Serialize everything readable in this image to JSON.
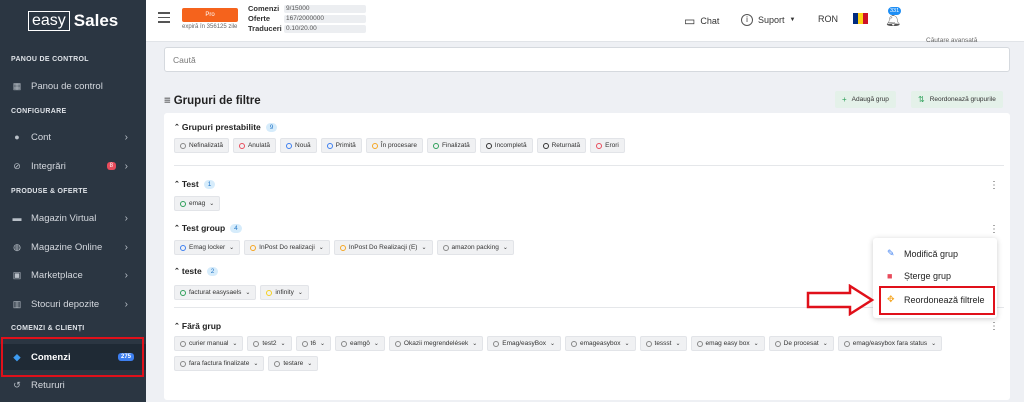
{
  "brand": {
    "logo_box": "easy",
    "logo_bold": "Sales"
  },
  "sidebar": {
    "sections": [
      "PANOU DE CONTROL",
      "CONFIGURARE",
      "PRODUSE & OFERTE",
      "COMENZI & CLIENȚI"
    ],
    "items": [
      {
        "label": "Panou de control",
        "icon": "dashboard-icon",
        "glyph": "▦"
      },
      {
        "label": "Cont",
        "icon": "user-icon",
        "glyph": "●"
      },
      {
        "label": "Integrări",
        "icon": "link-icon",
        "glyph": "⊘",
        "badge": "8"
      },
      {
        "label": "Magazin Virtual",
        "icon": "store-icon",
        "glyph": "▬"
      },
      {
        "label": "Magazine Online",
        "icon": "globe-icon",
        "glyph": "◍"
      },
      {
        "label": "Marketplace",
        "icon": "marketplace-icon",
        "glyph": "▣"
      },
      {
        "label": "Stocuri depozite",
        "icon": "warehouse-icon",
        "glyph": "▥"
      },
      {
        "label": "Comenzi",
        "icon": "tag-icon",
        "glyph": "◆",
        "badge": "275"
      },
      {
        "label": "Retururi",
        "icon": "return-icon",
        "glyph": "↺"
      }
    ]
  },
  "topbar": {
    "plan": "Pro",
    "expires": "expiră în 356125 zile",
    "stats": [
      {
        "k": "Comenzi",
        "v": "9/15000"
      },
      {
        "k": "Oferte",
        "v": "167/2000000"
      },
      {
        "k": "Traduceri",
        "v": "0.10/20.00"
      }
    ],
    "chat": "Chat",
    "support": "Suport",
    "currency": "RON",
    "notifications": "331",
    "flag_colors": [
      "#002b7f",
      "#fcd116",
      "#ce1126"
    ]
  },
  "main": {
    "top_cut": "Căutare avansată",
    "search_placeholder": "Caută",
    "title": "Grupuri de filtre",
    "btn_add": "Adaugă grup",
    "btn_reorder": "Reordonează grupurile",
    "groups": [
      {
        "name": "Grupuri prestabilite",
        "count": "9",
        "chips": [
          {
            "label": "Nefinalizată",
            "dot": "#888"
          },
          {
            "label": "Anulată",
            "dot": "#e84c5c"
          },
          {
            "label": "Nouă",
            "dot": "#3d7ff0"
          },
          {
            "label": "Primită",
            "dot": "#3d7ff0"
          },
          {
            "label": "În procesare",
            "dot": "#f5a623"
          },
          {
            "label": "Finalizată",
            "dot": "#2ea05a"
          },
          {
            "label": "Incompletă",
            "dot": "#333"
          },
          {
            "label": "Returnată",
            "dot": "#333"
          },
          {
            "label": "Erori",
            "dot": "#e84c5c"
          }
        ]
      },
      {
        "name": "Test",
        "count": "1",
        "chips": [
          {
            "label": "emag",
            "dot": "#2ea05a"
          }
        ]
      },
      {
        "name": "Test group",
        "count": "4",
        "chips": [
          {
            "label": "Emag locker",
            "dot": "#3d7ff0"
          },
          {
            "label": "InPost Do realizacji",
            "dot": "#f5a623"
          },
          {
            "label": "InPost Do Realizacji (E)",
            "dot": "#f5a623"
          },
          {
            "label": "amazon packing",
            "dot": "#888"
          }
        ]
      },
      {
        "name": "teste",
        "count": "2",
        "chips": [
          {
            "label": "facturat easysaels",
            "dot": "#2ea05a"
          },
          {
            "label": "infinity",
            "dot": "#f5d020"
          }
        ]
      },
      {
        "name": "Fără grup",
        "chips": [
          {
            "label": "curier manual"
          },
          {
            "label": "test2"
          },
          {
            "label": "t6"
          },
          {
            "label": "eamgô"
          },
          {
            "label": "Okazii megrendelések"
          },
          {
            "label": "Emag/easyBox"
          },
          {
            "label": "emageasybox"
          },
          {
            "label": "tessst"
          },
          {
            "label": "emag easy box"
          },
          {
            "label": "De procesat"
          },
          {
            "label": "emag/easybox fara status"
          },
          {
            "label": "fara factura finalizate"
          },
          {
            "label": "testare"
          }
        ]
      }
    ]
  },
  "menu": {
    "edit": "Modifică grup",
    "delete": "Șterge grup",
    "reorder": "Reordonează filtrele"
  },
  "accent": "#e0101a"
}
